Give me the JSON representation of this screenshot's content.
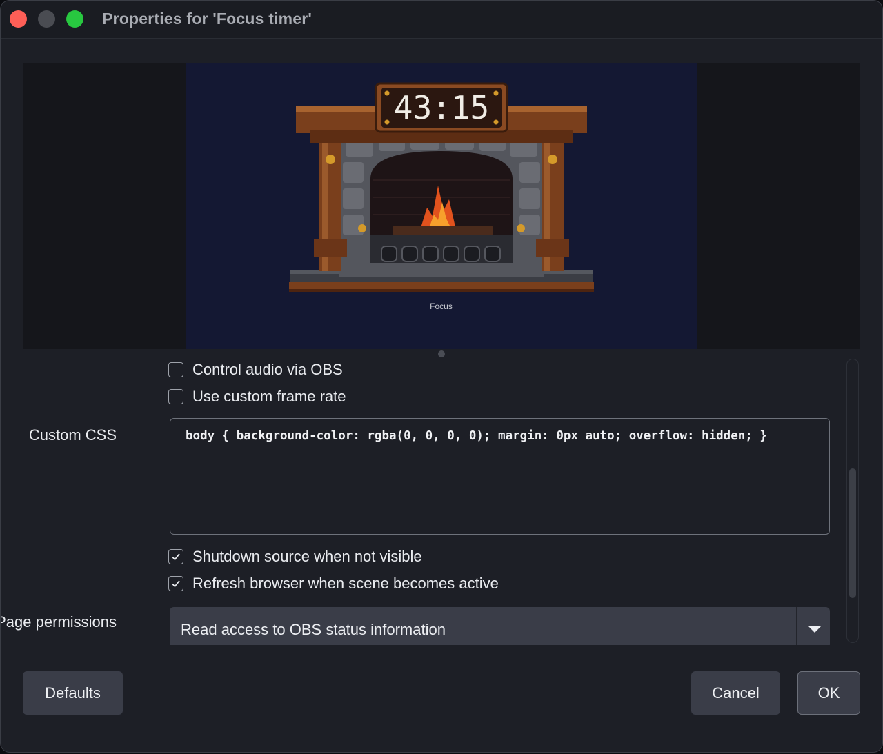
{
  "window": {
    "title": "Properties for 'Focus timer'"
  },
  "preview": {
    "timer": "43:15",
    "caption": "Focus"
  },
  "properties": {
    "control_audio": {
      "label": "Control audio via OBS",
      "checked": false
    },
    "custom_frame_rate": {
      "label": "Use custom frame rate",
      "checked": false
    },
    "custom_css": {
      "label": "Custom CSS",
      "value": "body { background-color: rgba(0, 0, 0, 0); margin: 0px auto; overflow: hidden; }"
    },
    "shutdown_source": {
      "label": "Shutdown source when not visible",
      "checked": true
    },
    "refresh_browser": {
      "label": "Refresh browser when scene becomes active",
      "checked": true
    },
    "page_permissions": {
      "label": "Page permissions",
      "selected": "Read access to OBS status information"
    }
  },
  "buttons": {
    "defaults": "Defaults",
    "cancel": "Cancel",
    "ok": "OK"
  },
  "colors": {
    "window_bg": "#1d1f26",
    "preview_canvas": "#141833",
    "button_bg": "#3a3d48"
  }
}
